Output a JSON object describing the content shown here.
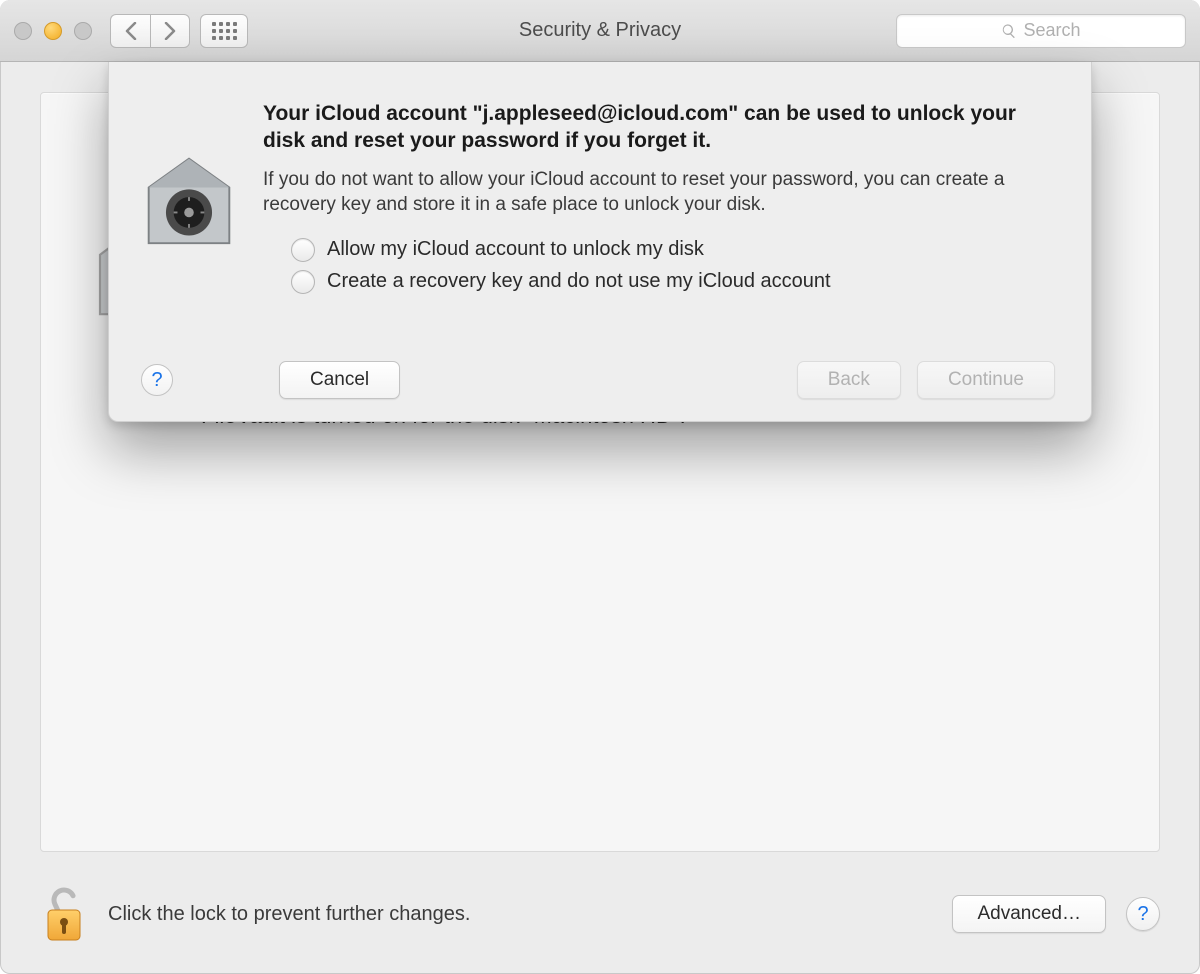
{
  "window": {
    "title": "Security & Privacy"
  },
  "toolbar": {
    "search_placeholder": "Search"
  },
  "background": {
    "status_text": "FileVault is turned on for the disk \"Macintosh HD\"."
  },
  "footer": {
    "lock_text": "Click the lock to prevent further changes.",
    "advanced_label": "Advanced…",
    "help_label": "?"
  },
  "sheet": {
    "heading": "Your iCloud account \"j.appleseed@icloud.com\" can be used to unlock your disk and reset your password if you forget it.",
    "subtext": "If you do not want to allow your iCloud account to reset your password, you can create a recovery key and store it in a safe place to unlock your disk.",
    "options": [
      "Allow my iCloud account to unlock my disk",
      "Create a recovery key and do not use my iCloud account"
    ],
    "help_label": "?",
    "cancel_label": "Cancel",
    "back_label": "Back",
    "continue_label": "Continue"
  }
}
